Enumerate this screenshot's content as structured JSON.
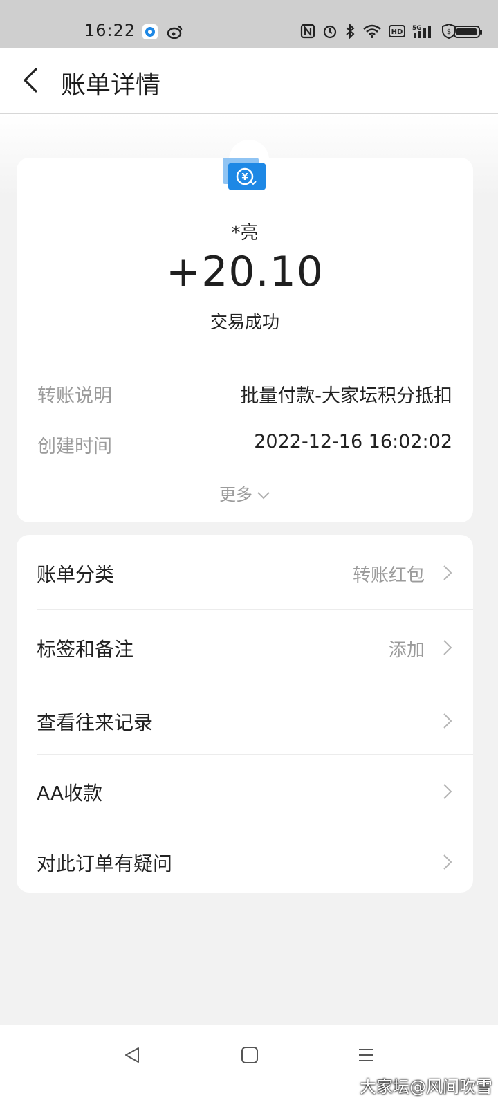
{
  "status_bar": {
    "time": "16:22",
    "icons": [
      "app-notification-icon",
      "weibo-icon",
      "nfc-icon",
      "alarm-icon",
      "bluetooth-icon",
      "wifi-icon",
      "hd-icon",
      "5g-signal-icon",
      "security-icon",
      "battery-icon"
    ]
  },
  "header": {
    "title": "账单详情",
    "back_icon": "chevron-left-icon"
  },
  "summary": {
    "icon": "transfer-yuan-icon",
    "counterparty": "*亮",
    "amount": "+20.10",
    "status": "交易成功",
    "details": [
      {
        "label": "转账说明",
        "value": "批量付款-大家坛积分抵扣"
      },
      {
        "label": "创建时间",
        "value": "2022-12-16 16:02:02"
      }
    ],
    "more_label": "更多"
  },
  "actions": [
    {
      "label": "账单分类",
      "value": "转账红包"
    },
    {
      "label": "标签和备注",
      "value": "添加"
    },
    {
      "label": "查看往来记录",
      "value": ""
    },
    {
      "label": "AA收款",
      "value": ""
    },
    {
      "label": "对此订单有疑问",
      "value": ""
    }
  ],
  "nav_bar": {
    "buttons": [
      "nav-back-icon",
      "nav-home-icon",
      "nav-menu-icon"
    ]
  },
  "watermark": "大家坛@风间吹雪",
  "colors": {
    "accent": "#1e88e5",
    "background": "#f2f2f2",
    "card": "#ffffff",
    "muted_text": "#9b9b9b"
  }
}
